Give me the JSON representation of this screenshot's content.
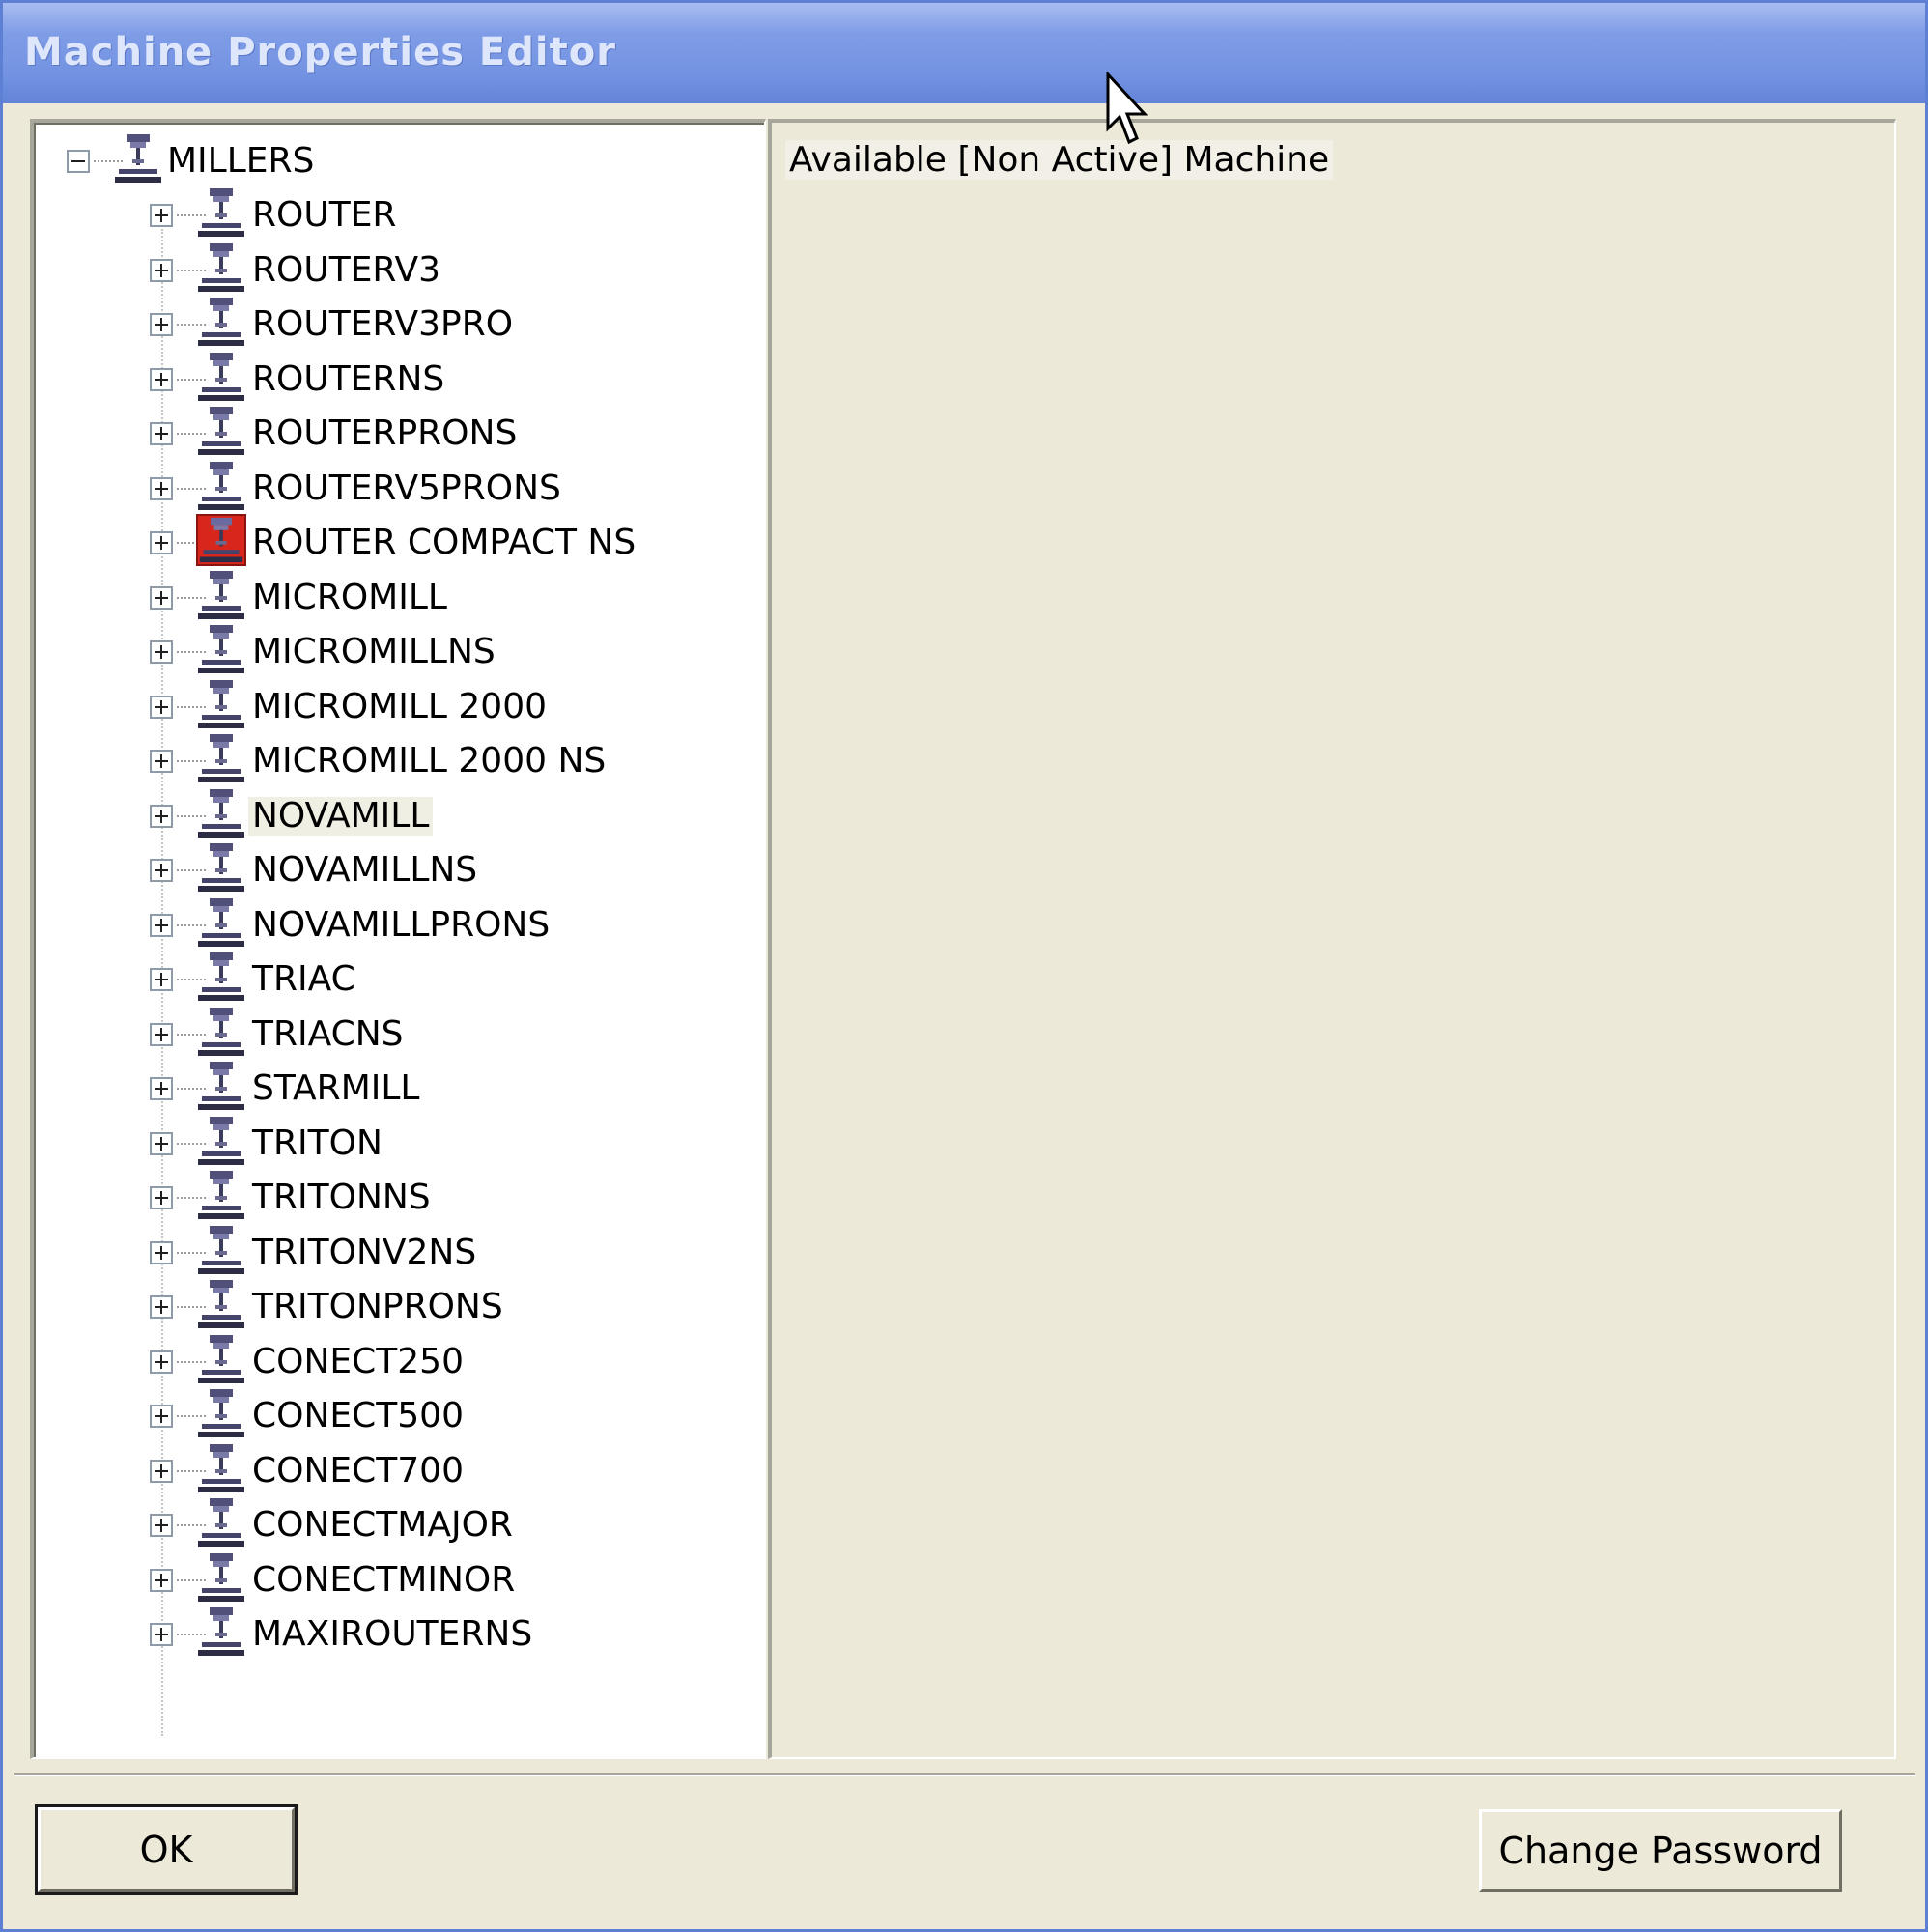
{
  "window": {
    "title": "Machine Properties Editor"
  },
  "tree": {
    "root": {
      "label": "MILLERS",
      "expanded": true
    },
    "items": [
      {
        "label": "ROUTER"
      },
      {
        "label": "ROUTERV3"
      },
      {
        "label": "ROUTERV3PRO"
      },
      {
        "label": "ROUTERNS"
      },
      {
        "label": "ROUTERPRONS"
      },
      {
        "label": "ROUTERV5PRONS"
      },
      {
        "label": "ROUTER COMPACT NS",
        "selected": true
      },
      {
        "label": "MICROMILL"
      },
      {
        "label": "MICROMILLNS"
      },
      {
        "label": "MICROMILL 2000"
      },
      {
        "label": "MICROMILL 2000 NS"
      },
      {
        "label": "NOVAMILL",
        "highlighted": true
      },
      {
        "label": "NOVAMILLNS"
      },
      {
        "label": "NOVAMILLPRONS"
      },
      {
        "label": "TRIAC"
      },
      {
        "label": "TRIACNS"
      },
      {
        "label": "STARMILL"
      },
      {
        "label": "TRITON"
      },
      {
        "label": "TRITONNS"
      },
      {
        "label": "TRITONV2NS"
      },
      {
        "label": "TRITONPRONS"
      },
      {
        "label": "CONECT250"
      },
      {
        "label": "CONECT500"
      },
      {
        "label": "CONECT700"
      },
      {
        "label": "CONECTMAJOR"
      },
      {
        "label": "CONECTMINOR"
      },
      {
        "label": "MAXIROUTERNS"
      }
    ]
  },
  "info_panel": {
    "status_text": "Available [Non Active] Machine"
  },
  "buttons": {
    "ok_label": "OK",
    "change_password_label": "Change Password"
  },
  "colors": {
    "titlebar": "#7393e2",
    "dialog_bg": "#ece9d8",
    "selected_icon": "#d9261c"
  }
}
